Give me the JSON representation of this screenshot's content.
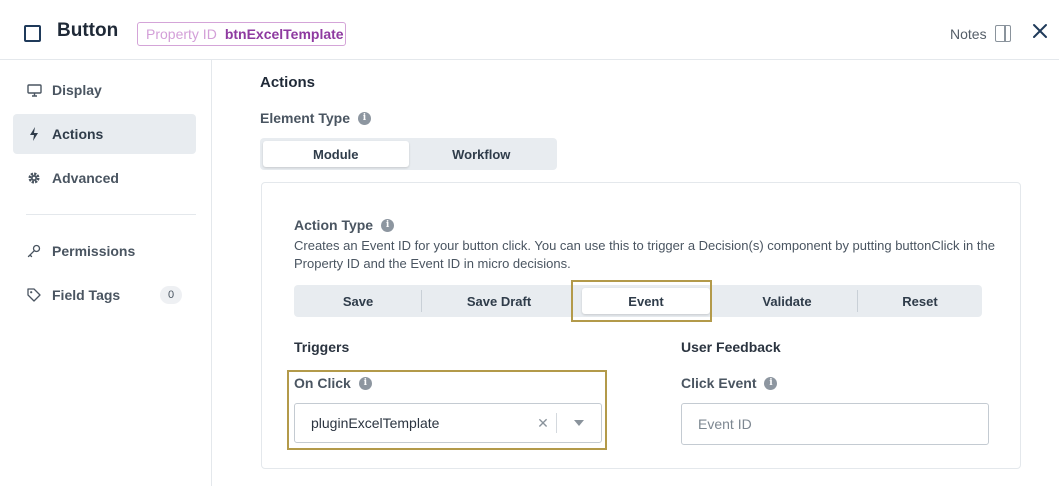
{
  "header": {
    "title": "Button",
    "property_label": "Property ID",
    "property_value": "btnExcelTemplate",
    "notes_label": "Notes",
    "close_icon": "close-icon"
  },
  "sidebar": {
    "items": [
      {
        "label": "Display",
        "icon": "monitor-icon"
      },
      {
        "label": "Actions",
        "icon": "bolt-icon",
        "active": true
      },
      {
        "label": "Advanced",
        "icon": "gear-icon"
      },
      {
        "label": "Permissions",
        "icon": "key-icon"
      },
      {
        "label": "Field Tags",
        "icon": "tag-icon",
        "count": "0"
      }
    ]
  },
  "main": {
    "section_title": "Actions",
    "element_type": {
      "label": "Element Type",
      "options": [
        "Module",
        "Workflow"
      ],
      "selected": "Module"
    },
    "action_type": {
      "label": "Action Type",
      "description": "Creates an Event ID for your button click. You can use this to trigger a Decision(s) component by putting buttonClick in the Property ID and the Event ID in micro decisions.",
      "options": [
        "Save",
        "Save Draft",
        "Event",
        "Validate",
        "Reset"
      ],
      "selected": "Event"
    },
    "triggers": {
      "title": "Triggers",
      "on_click_label": "On Click",
      "on_click_value": "pluginExcelTemplate"
    },
    "user_feedback": {
      "title": "User Feedback",
      "click_event_label": "Click Event",
      "click_event_placeholder": "Event ID"
    }
  },
  "colors": {
    "highlight_border": "#b39a4a",
    "property_value": "#8e3aa0",
    "active_nav_bg": "#e8ecf0"
  }
}
